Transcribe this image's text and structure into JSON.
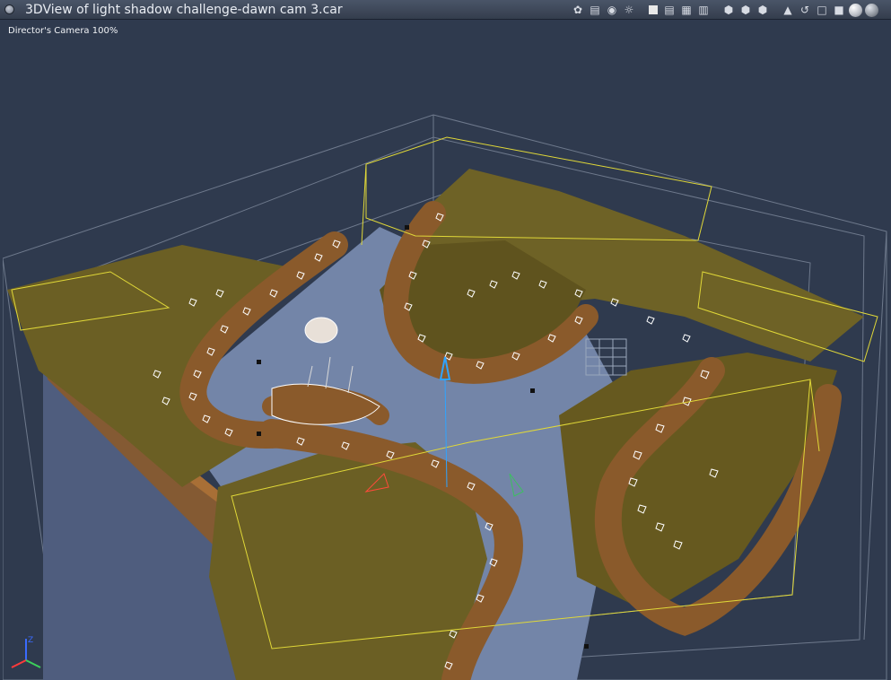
{
  "window": {
    "title": "3DView of light shadow challenge-dawn cam 3.car"
  },
  "toolbar": {
    "icons": [
      "light-handles-icon",
      "camera-list-icon",
      "camera-icon",
      "sphere-orient-icon",
      "single-view-icon",
      "two-view-icon",
      "four-view-icon",
      "three-view-icon",
      "box-ortho-icon",
      "box-perspective-icon",
      "box-free-icon",
      "move-icon",
      "rotate-icon",
      "wireframe-cube-icon",
      "solid-cube-icon",
      "render-ball-icon",
      "shaded-ball-icon"
    ]
  },
  "viewport": {
    "camera_label": "Director's Camera 100%"
  },
  "axis": {
    "x": "X",
    "y": "Y",
    "z": "Z"
  },
  "colors": {
    "background": "#2f3a4e",
    "terrain": "#6b5f24",
    "rock": "#8a5a2b",
    "water": "#7385a8",
    "wire": "#7e899c",
    "light_box": "#e0d838"
  }
}
